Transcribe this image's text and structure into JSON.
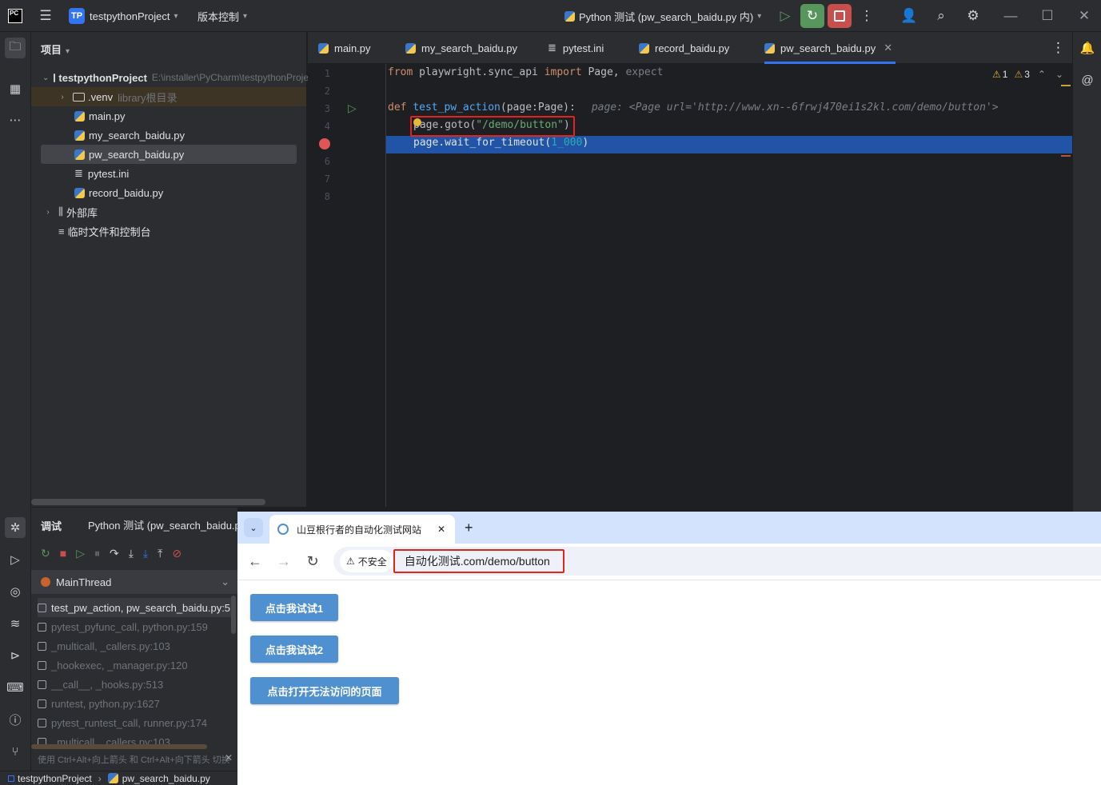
{
  "titlebar": {
    "logo": "PC",
    "project_badge": "TP",
    "project_name": "testpythonProject",
    "vcs_label": "版本控制",
    "run_config": "Python 测试 (pw_search_baidu.py 内)"
  },
  "project_panel": {
    "title": "项目",
    "root_name": "testpythonProject",
    "root_path": "E:\\installer\\PyCharm\\testpythonProject",
    "venv_name": ".venv",
    "venv_hint": "library根目录",
    "files": [
      "main.py",
      "my_search_baidu.py",
      "pw_search_baidu.py",
      "pytest.ini",
      "record_baidu.py"
    ],
    "external_libs": "外部库",
    "scratches": "临时文件和控制台"
  },
  "editor": {
    "tabs": [
      "main.py",
      "my_search_baidu.py",
      "pytest.ini",
      "record_baidu.py",
      "pw_search_baidu.py"
    ],
    "warnings_a": "1",
    "warnings_b": "3",
    "line_numbers": [
      "1",
      "2",
      "3",
      "4",
      "5",
      "6",
      "7",
      "8"
    ],
    "code": {
      "l1_from": "from",
      "l1_module": " playwright.sync_api ",
      "l1_import": "import",
      "l1_names": " Page, ",
      "l1_expect": "expect",
      "l3_def": "def",
      "l3_space": " ",
      "l3_fname": "test_pw_action",
      "l3_sig": "(page:Page):",
      "l3_hint": "page: <Page url='http://www.xn--6frwj470ei1s2kl.com/demo/button'>",
      "l4_pre": "page.goto(",
      "l4_str": "\"/demo/button\"",
      "l4_post": ")",
      "l5_pre": "page.wait_for_timeout(",
      "l5_num": "1_000",
      "l5_post": ")"
    }
  },
  "debug": {
    "tab_label": "调试",
    "session_label": "Python 测试 (pw_search_baidu.py 内)",
    "thread": "MainThread",
    "frames": [
      "test_pw_action, pw_search_baidu.py:5",
      "pytest_pyfunc_call, python.py:159",
      "_multicall, _callers.py:103",
      "_hookexec, _manager.py:120",
      "__call__, _hooks.py:513",
      "runtest, python.py:1627",
      "pytest_runtest_call, runner.py:174",
      "_multicall, _callers.py:103"
    ],
    "tip": "使用 Ctrl+Alt+向上箭头 和 Ctrl+Alt+向下箭头 切换帧"
  },
  "statusbar": {
    "project": "testpythonProject",
    "file": "pw_search_baidu.py"
  },
  "browser": {
    "tab_title": "山豆根行者的自动化测试网站",
    "security_label": "不安全",
    "url": "自动化测试.com/demo/button",
    "buttons": [
      "点击我试试1",
      "点击我试试2",
      "点击打开无法访问的页面"
    ]
  },
  "colors": {
    "accent": "#3574f0",
    "breakpoint": "#e05555",
    "exec_line": "#2154a6",
    "highlight_box": "#e1251b",
    "web_button": "#4f90d0"
  }
}
